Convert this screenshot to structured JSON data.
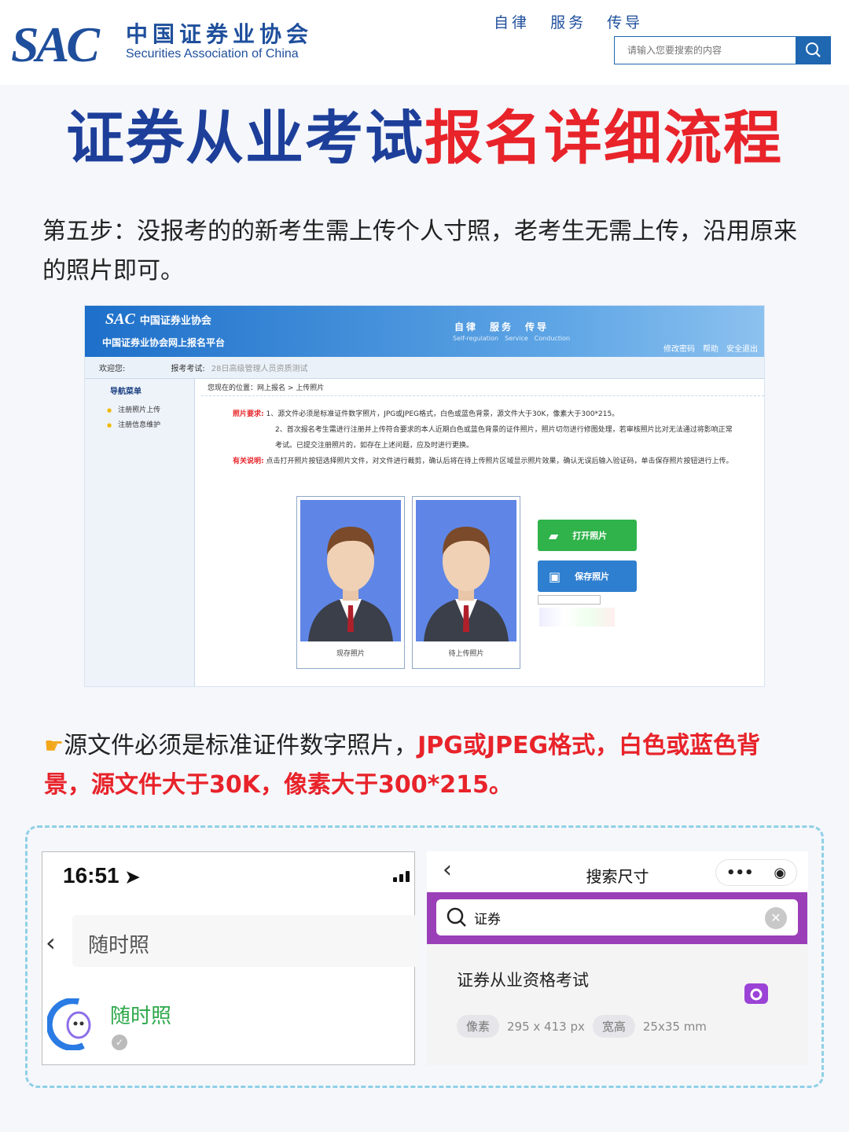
{
  "header": {
    "logo_mark": "SAC",
    "org_cn": "中国证券业协会",
    "org_en": "Securities Association of China",
    "slogan": [
      "自律",
      "服务",
      "传导"
    ],
    "search_placeholder": "请输入您要搜索的内容"
  },
  "title": {
    "blue": "证券从业考试",
    "red": "报名详细流程"
  },
  "step_text": "第五步：没报考的的新考生需上传个人寸照，老考生无需上传，沿用原来的照片即可。",
  "platform": {
    "logo_mark": "SAC",
    "logo_cn": "中国证券业协会",
    "name": "中国证券业协会网上报名平台",
    "slogan": "自律　服务　传导",
    "slogan_en": "Self-regulation　Service　Conduction",
    "top_links": "修改密码　帮助　安全退出",
    "welcome": "欢迎您:",
    "exam_label": "报考考试:",
    "exam_value": "28日高级管理人员资质测试",
    "nav_title": "导航菜单",
    "side_items": [
      "注册照片上传",
      "注册信息维护"
    ],
    "breadcrumb": "您现在的位置：网上报名 > 上传照片",
    "req_label": "照片要求:",
    "req_1": "1、源文件必须是标准证件数字照片，JPG或JPEG格式，白色或蓝色背景，源文件大于30K，像素大于300*215。",
    "req_2": "2、首次报名考生需进行注册并上传符合要求的本人近期白色或蓝色背景的证件照片，照片切勿进行修图处理，若审核照片比对无法通过将影响正常考试。已提交注册照片的，如存在上述问题，应及时进行更换。",
    "note_label": "有关说明:",
    "note_text": "点击打开照片按钮选择照片文件，对文件进行裁剪，确认后将在待上传照片区域显示照片效果，确认无误后输入验证码，单击保存照片按钮进行上传。",
    "photo_caps": [
      "现存照片",
      "待上传照片"
    ],
    "btn_open": "打开照片",
    "btn_save": "保存照片"
  },
  "notice": {
    "plain": "源文件必须是标准证件数字照片，",
    "red": "JPG或JPEG格式，白色或蓝色背景，源文件大于30K，像素大于300*215。"
  },
  "phone": {
    "time": "16:51",
    "search_value": "随时照",
    "result_name": "随时照"
  },
  "mini": {
    "title": "搜索尺寸",
    "search_value": "证券",
    "result_title": "证券从业资格考试",
    "pixel_label": "像素",
    "pixel_value": "295 x 413 px",
    "size_label": "宽高",
    "size_value": "25x35 mm"
  },
  "colors": {
    "brand_blue": "#1d3f9a",
    "accent_red": "#e8232a",
    "wx_green": "#2ea84a",
    "purple": "#9a3fb8"
  }
}
